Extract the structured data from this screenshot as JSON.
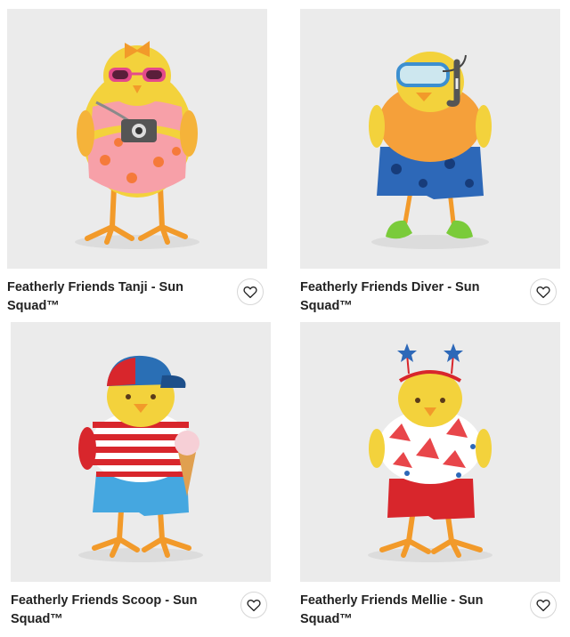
{
  "products": [
    {
      "title": "Featherly Friends Tanji - Sun Squad™",
      "image_alt": "yellow felt bird with pink sunglasses, camera and floral swimsuit"
    },
    {
      "title": "Featherly Friends Diver - Sun Squad™",
      "image_alt": "yellow felt bird with snorkel mask, orange top, blue shorts and green flippers"
    },
    {
      "title": "Featherly Friends Scoop - Sun Squad™",
      "image_alt": "yellow felt bird with blue cap, striped shirt and ice cream cone"
    },
    {
      "title": "Featherly Friends Mellie - Sun Squad™",
      "image_alt": "yellow felt bird with star headband, watermelon shirt and red shorts"
    }
  ],
  "icons": {
    "favorite": "heart-outline-icon"
  },
  "colors": {
    "bird_yellow": "#f3d23c",
    "legs_orange": "#f29a2a",
    "image_bg": "#ebebeb"
  }
}
